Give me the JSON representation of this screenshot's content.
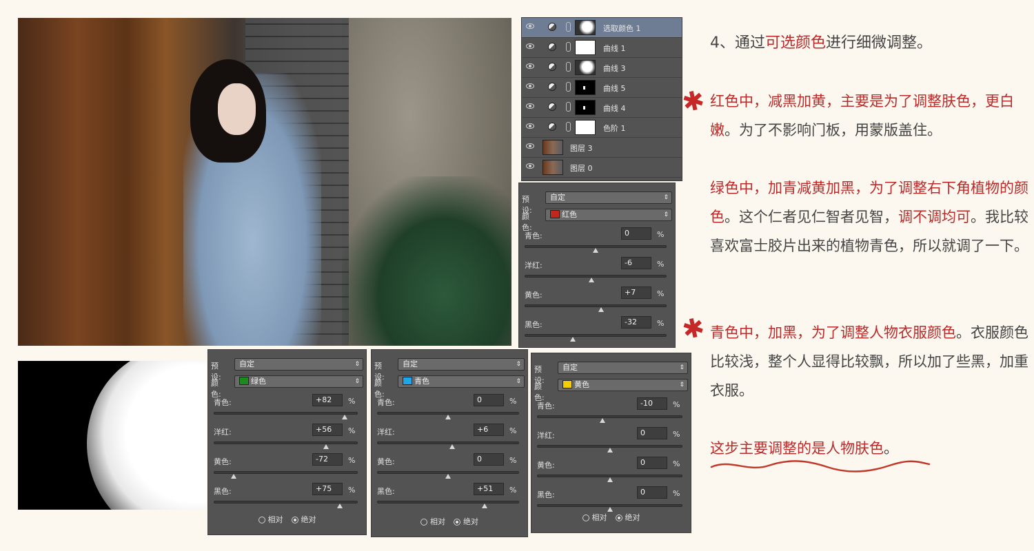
{
  "layers": [
    {
      "name": "选取颜色 1",
      "type": "adjustment",
      "thumb": "mixed",
      "active": true
    },
    {
      "name": "曲线 1",
      "type": "adjustment",
      "thumb": "white",
      "active": false
    },
    {
      "name": "曲线 3",
      "type": "adjustment",
      "thumb": "mixed",
      "active": false
    },
    {
      "name": "曲线 5",
      "type": "adjustment",
      "thumb": "black-dot",
      "active": false
    },
    {
      "name": "曲线 4",
      "type": "adjustment",
      "thumb": "black-dot",
      "active": false
    },
    {
      "name": "色阶 1",
      "type": "adjustment",
      "thumb": "white",
      "active": false
    },
    {
      "name": "图层 3",
      "type": "raster",
      "thumb": "photo",
      "active": false
    },
    {
      "name": "图层 0",
      "type": "raster",
      "thumb": "photo",
      "active": false
    }
  ],
  "panels": [
    {
      "id": "red",
      "preset_label": "预设:",
      "preset_value": "自定",
      "color_label": "颜色:",
      "color_name": "红色",
      "swatch": "#c0281c",
      "sliders": [
        {
          "label": "青色:",
          "value": "0",
          "pos": 0.5
        },
        {
          "label": "洋红:",
          "value": "-6",
          "pos": 0.47
        },
        {
          "label": "黄色:",
          "value": "+7",
          "pos": 0.54
        },
        {
          "label": "黑色:",
          "value": "-32",
          "pos": 0.34
        }
      ],
      "show_radios": false
    },
    {
      "id": "green",
      "preset_label": "预设:",
      "preset_value": "自定",
      "color_label": "颜色:",
      "color_name": "绿色",
      "swatch": "#1d8a1d",
      "sliders": [
        {
          "label": "青色:",
          "value": "+82",
          "pos": 0.91
        },
        {
          "label": "洋红:",
          "value": "+56",
          "pos": 0.78
        },
        {
          "label": "黄色:",
          "value": "-72",
          "pos": 0.14
        },
        {
          "label": "黑色:",
          "value": "+75",
          "pos": 0.875
        }
      ],
      "show_radios": true
    },
    {
      "id": "cyan",
      "preset_label": "预设:",
      "preset_value": "自定",
      "color_label": "颜色:",
      "color_name": "青色",
      "swatch": "#1ea7e8",
      "sliders": [
        {
          "label": "青色:",
          "value": "0",
          "pos": 0.5
        },
        {
          "label": "洋红:",
          "value": "+6",
          "pos": 0.53
        },
        {
          "label": "黄色:",
          "value": "0",
          "pos": 0.5
        },
        {
          "label": "黑色:",
          "value": "+51",
          "pos": 0.755
        }
      ],
      "show_radios": true
    },
    {
      "id": "yellow",
      "preset_label": "预设:",
      "preset_value": "自定",
      "color_label": "颜色:",
      "color_name": "黄色",
      "swatch": "#f2d000",
      "sliders": [
        {
          "label": "青色:",
          "value": "-10",
          "pos": 0.45
        },
        {
          "label": "洋红:",
          "value": "0",
          "pos": 0.5
        },
        {
          "label": "黄色:",
          "value": "0",
          "pos": 0.5
        },
        {
          "label": "黑色:",
          "value": "0",
          "pos": 0.5
        }
      ],
      "show_radios": true
    }
  ],
  "radios": {
    "relative": "相对",
    "absolute": "绝对"
  },
  "percent": "%",
  "text": {
    "p1": [
      {
        "t": "4、通过",
        "red": false
      },
      {
        "t": "可选颜色",
        "red": true
      },
      {
        "t": "进行细微调整。",
        "red": false
      }
    ],
    "p2": [
      {
        "t": "红色中，减黑加黄，主要是为了调整肤色，",
        "red": true
      },
      {
        "t": "更白嫩",
        "red": true
      },
      {
        "t": "。为了不影响门板，用蒙版盖住。",
        "red": false
      }
    ],
    "p3": [
      {
        "t": "绿色中，加青减黄加黑，为了调整右下角植物的颜色",
        "red": true
      },
      {
        "t": "。这个仁者见仁智者见智，",
        "red": false
      },
      {
        "t": "调不调均可",
        "red": true
      },
      {
        "t": "。我比较喜欢富士胶片出来的植物青色，所以就调了一下。",
        "red": false
      }
    ],
    "p4": [
      {
        "t": "青色中，加黑，为了调整人物衣服颜色",
        "red": true
      },
      {
        "t": "。衣服颜色比较浅，整个人显得比较飘，所以加了些黑，加重衣服。",
        "red": false
      }
    ],
    "p5": [
      {
        "t": "这步主要调整的是人物肤色",
        "red": true
      },
      {
        "t": "。",
        "red": false
      }
    ]
  },
  "colors": {
    "accent_red": "#b92a2a",
    "panel_bg": "#535353",
    "page_bg": "#fdf8ef"
  }
}
